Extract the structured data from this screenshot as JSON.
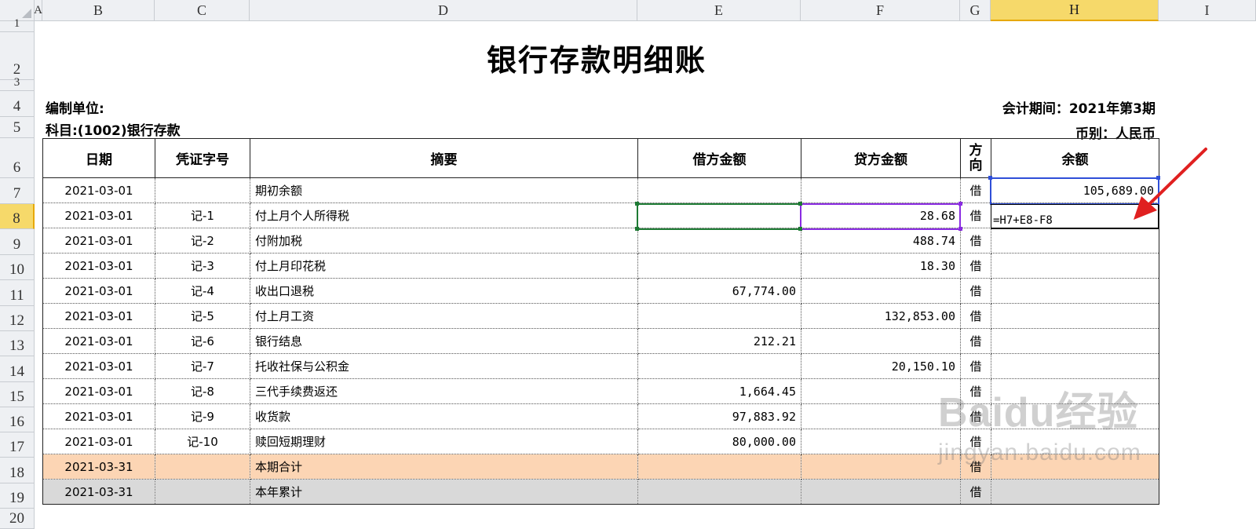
{
  "columns": [
    "A",
    "B",
    "C",
    "D",
    "E",
    "F",
    "G",
    "H",
    "I"
  ],
  "active_column": "H",
  "rows": [
    "1",
    "2",
    "3",
    "4",
    "5",
    "6",
    "7",
    "8",
    "9",
    "10",
    "11",
    "12",
    "13",
    "14",
    "15",
    "16",
    "17",
    "18",
    "19",
    "20"
  ],
  "active_row": "8",
  "sheet": {
    "title": "银行存款明细账",
    "unit_label": "编制单位:",
    "account_label": "科目:(1002)银行存款",
    "period_label": "会计期间：2021年第3期",
    "currency_label": "币别：人民币",
    "headers": {
      "date": "日期",
      "voucher": "凭证字号",
      "summary": "摘要",
      "debit": "借方金额",
      "credit": "贷方金额",
      "direction": "方向",
      "balance": "余额"
    },
    "entries": [
      {
        "date": "2021-03-01",
        "voucher": "",
        "summary": "期初余额",
        "debit": "",
        "credit": "",
        "direction": "借",
        "balance": "105,689.00"
      },
      {
        "date": "2021-03-01",
        "voucher": "记-1",
        "summary": "付上月个人所得税",
        "debit": "",
        "credit": "28.68",
        "direction": "借",
        "balance": ""
      },
      {
        "date": "2021-03-01",
        "voucher": "记-2",
        "summary": "付附加税",
        "debit": "",
        "credit": "488.74",
        "direction": "借",
        "balance": ""
      },
      {
        "date": "2021-03-01",
        "voucher": "记-3",
        "summary": "付上月印花税",
        "debit": "",
        "credit": "18.30",
        "direction": "借",
        "balance": ""
      },
      {
        "date": "2021-03-01",
        "voucher": "记-4",
        "summary": "收出口退税",
        "debit": "67,774.00",
        "credit": "",
        "direction": "借",
        "balance": ""
      },
      {
        "date": "2021-03-01",
        "voucher": "记-5",
        "summary": "付上月工资",
        "debit": "",
        "credit": "132,853.00",
        "direction": "借",
        "balance": ""
      },
      {
        "date": "2021-03-01",
        "voucher": "记-6",
        "summary": "银行结息",
        "debit": "212.21",
        "credit": "",
        "direction": "借",
        "balance": ""
      },
      {
        "date": "2021-03-01",
        "voucher": "记-7",
        "summary": "托收社保与公积金",
        "debit": "",
        "credit": "20,150.10",
        "direction": "借",
        "balance": ""
      },
      {
        "date": "2021-03-01",
        "voucher": "记-8",
        "summary": "三代手续费返还",
        "debit": "1,664.45",
        "credit": "",
        "direction": "借",
        "balance": ""
      },
      {
        "date": "2021-03-01",
        "voucher": "记-9",
        "summary": "收货款",
        "debit": "97,883.92",
        "credit": "",
        "direction": "借",
        "balance": ""
      },
      {
        "date": "2021-03-01",
        "voucher": "记-10",
        "summary": "赎回短期理财",
        "debit": "80,000.00",
        "credit": "",
        "direction": "借",
        "balance": ""
      },
      {
        "date": "2021-03-31",
        "voucher": "",
        "summary": "本期合计",
        "debit": "",
        "credit": "",
        "direction": "借",
        "balance": ""
      },
      {
        "date": "2021-03-31",
        "voucher": "",
        "summary": "本年累计",
        "debit": "",
        "credit": "",
        "direction": "借",
        "balance": ""
      }
    ],
    "formula_in_edit": "=H7+E8-F8"
  },
  "watermark": {
    "brand": "Baidu经验",
    "url": "jingyan.baidu.com"
  },
  "colors": {
    "total_row": "#fcd5b4",
    "ytd_row": "#d9d9d9",
    "annotation_arrow": "#e02020",
    "active_header": "#f6d96a"
  }
}
